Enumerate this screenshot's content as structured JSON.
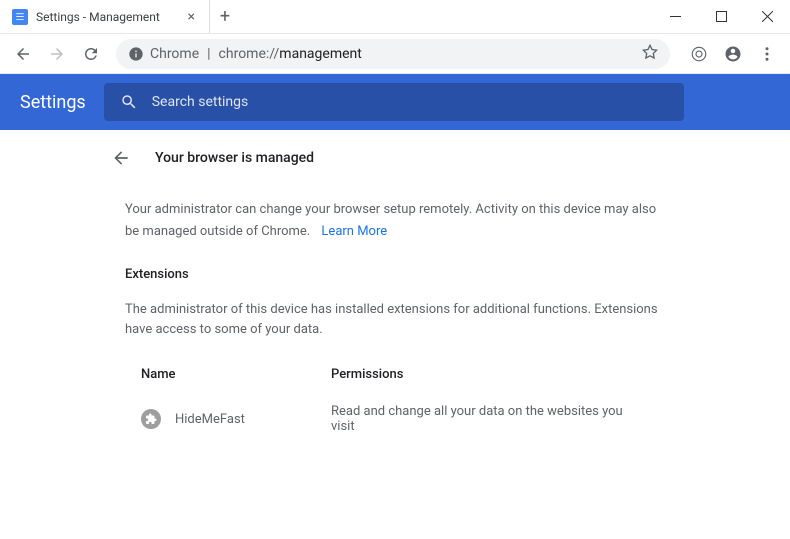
{
  "window": {
    "tab_title": "Settings - Management"
  },
  "address": {
    "scheme_label": "Chrome",
    "url_host": "chrome://",
    "url_path": "management"
  },
  "header": {
    "title": "Settings",
    "search_placeholder": "Search settings"
  },
  "page": {
    "title": "Your browser is managed",
    "intro": "Your administrator can change your browser setup remotely. Activity on this device may also be managed outside of Chrome.",
    "learn_more": "Learn More",
    "extensions_heading": "Extensions",
    "extensions_intro": "The administrator of this device has installed extensions for additional functions. Extensions have access to some of your data.",
    "columns": {
      "name": "Name",
      "permissions": "Permissions"
    },
    "extensions": [
      {
        "name": "HideMeFast",
        "permissions": "Read and change all your data on the websites you visit"
      }
    ]
  }
}
